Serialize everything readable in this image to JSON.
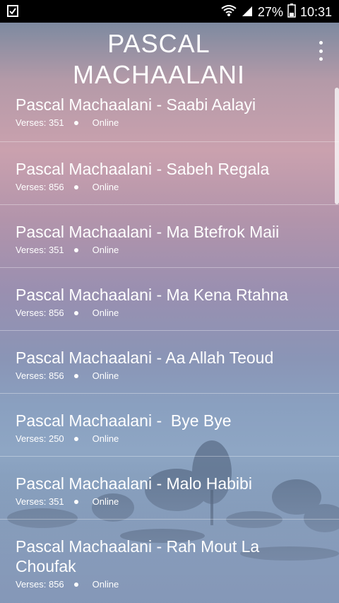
{
  "status_bar": {
    "battery": "27%",
    "time": "10:31"
  },
  "header": {
    "title_line1": "PASCAL",
    "title_line2": "MACHAALANI"
  },
  "items": [
    {
      "title": "Pascal Machaalani - Saabi Aalayi",
      "verses": "Verses: 351",
      "status": "Online"
    },
    {
      "title": "Pascal Machaalani - Sabeh Regala",
      "verses": "Verses: 856",
      "status": "Online"
    },
    {
      "title": "Pascal Machaalani - Ma Btefrok Maii",
      "verses": "Verses: 351",
      "status": "Online"
    },
    {
      "title": "Pascal Machaalani - Ma Kena Rtahna",
      "verses": "Verses: 856",
      "status": "Online"
    },
    {
      "title": "Pascal Machaalani - Aa Allah Teoud",
      "verses": "Verses: 856",
      "status": "Online"
    },
    {
      "title": "Pascal Machaalani -  Bye Bye",
      "verses": "Verses: 250",
      "status": "Online"
    },
    {
      "title": "Pascal Machaalani - Malo Habibi",
      "verses": "Verses: 351",
      "status": "Online"
    },
    {
      "title": "Pascal Machaalani - Rah Mout La Choufak",
      "verses": "Verses: 856",
      "status": "Online"
    }
  ]
}
